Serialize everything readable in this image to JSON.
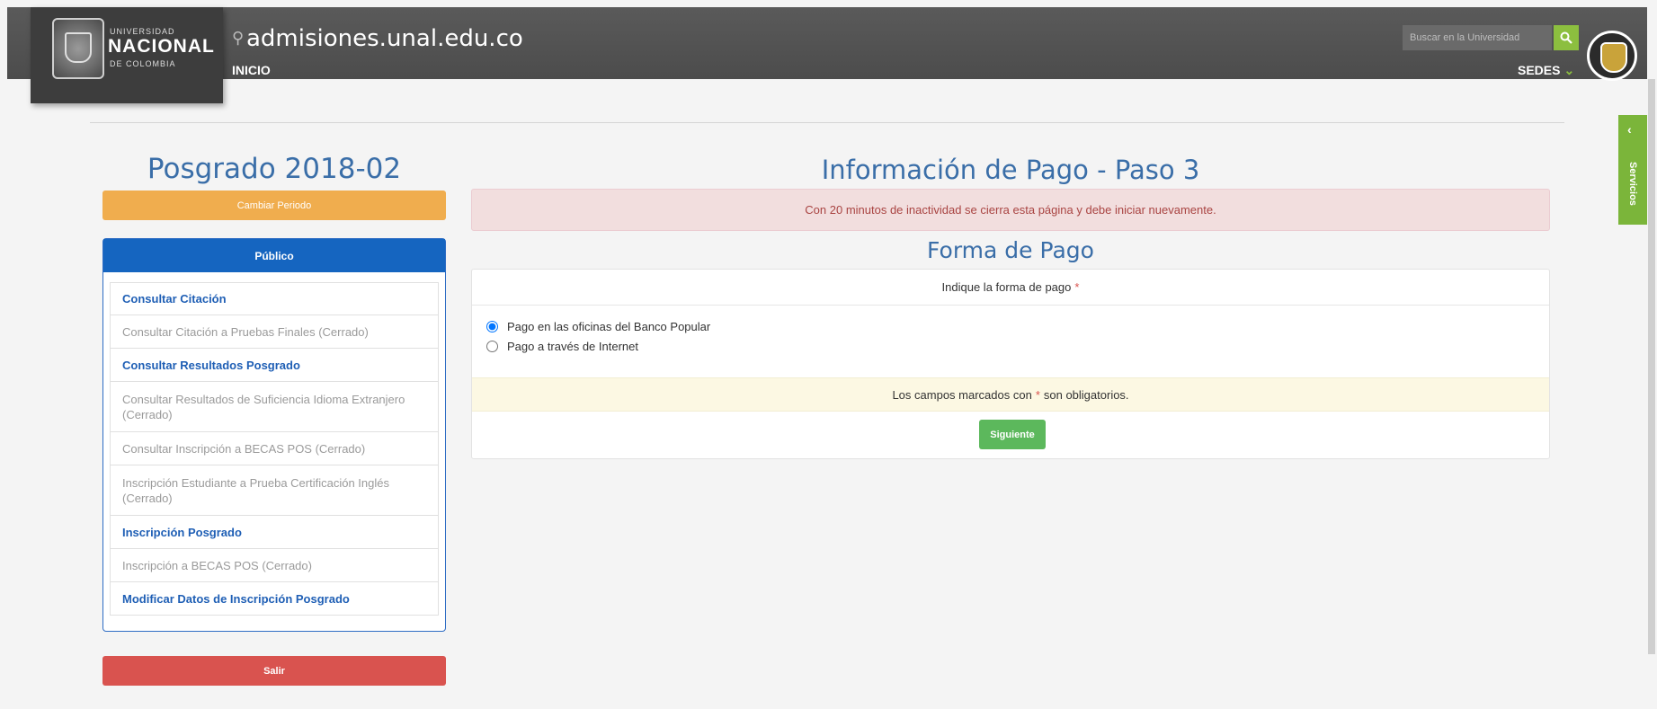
{
  "header": {
    "logo": {
      "line1": "UNIVERSIDAD",
      "line2": "NACIONAL",
      "line3": "DE COLOMBIA"
    },
    "site_title": "admisiones.unal.edu.co",
    "nav_inicio": "INICIO",
    "search_placeholder": "Buscar en la Universidad",
    "sedes_label": "SEDES",
    "sedes_caret": "⌄"
  },
  "side_tab": {
    "arrow": "‹",
    "label": "Servicios"
  },
  "sidebar": {
    "period_title": "Posgrado 2018-02",
    "change_period_button": "Cambiar Periodo",
    "panel_title": "Público",
    "items": [
      {
        "label": "Consultar Citación",
        "state": "active"
      },
      {
        "label": "Consultar Citación a Pruebas Finales (Cerrado)",
        "state": "closed"
      },
      {
        "label": "Consultar Resultados Posgrado",
        "state": "active"
      },
      {
        "label": "Consultar Resultados de Suficiencia Idioma Extranjero (Cerrado)",
        "state": "closed"
      },
      {
        "label": "Consultar Inscripción a BECAS POS (Cerrado)",
        "state": "closed"
      },
      {
        "label": "Inscripción Estudiante a Prueba Certificación Inglés (Cerrado)",
        "state": "closed"
      },
      {
        "label": "Inscripción Posgrado",
        "state": "active"
      },
      {
        "label": "Inscripción a BECAS POS (Cerrado)",
        "state": "closed"
      },
      {
        "label": "Modificar Datos de Inscripción Posgrado",
        "state": "active"
      }
    ],
    "exit_button": "Salir"
  },
  "main": {
    "title": "Información de Pago - Paso 3",
    "timeout_alert": "Con 20 minutos de inactividad se cierra esta página y debe iniciar nuevamente.",
    "section_title": "Forma de Pago",
    "form_prompt": "Indique la forma de pago",
    "required_mark": "*",
    "options": [
      {
        "label": "Pago en las oficinas del Banco Popular",
        "checked": true
      },
      {
        "label": "Pago a través de Internet",
        "checked": false
      }
    ],
    "notice_before": "Los campos marcados con",
    "notice_after": "son obligatorios.",
    "next_button": "Siguiente"
  },
  "colors": {
    "header_bg": "#555555",
    "accent_green": "#8cbf3f",
    "title_blue": "#3a6ea8",
    "panel_blue": "#1565c0",
    "warning_orange": "#f0ad4e",
    "danger_red": "#d9534f",
    "success_green": "#5cb85c"
  }
}
